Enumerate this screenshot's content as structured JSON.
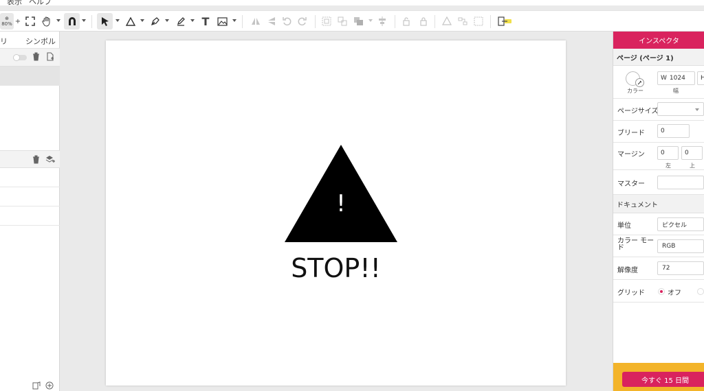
{
  "menu": {
    "view": "表示",
    "help": "ヘルプ"
  },
  "toolbar": {
    "zoom": "80%",
    "text_tool": "T",
    "plus": "+"
  },
  "left_panel": {
    "tab_left": "リ",
    "tab_symbol": "シンボル"
  },
  "canvas": {
    "exclaim": "!",
    "stop_text": "STOP!!"
  },
  "inspector": {
    "tab": "インスペクタ",
    "page_header": "ページ (ページ 1)",
    "color_caption": "カラー",
    "width_prefix": "W",
    "width_value": "1024",
    "width_caption": "幅",
    "height_prefix": "H",
    "page_size_label": "ページサイズ",
    "bleed_label": "ブリード",
    "bleed_value": "0",
    "margin_label": "マージン",
    "margin_left": "0",
    "margin_top": "0",
    "margin_left_caption": "左",
    "margin_top_caption": "上",
    "master_label": "マスター",
    "document_header": "ドキュメント",
    "unit_label": "単位",
    "unit_value": "ピクセル",
    "color_mode_label": "カラー モード",
    "color_mode_value": "RGB",
    "resolution_label": "解像度",
    "resolution_value": "72",
    "grid_label": "グリッド",
    "grid_off": "オフ",
    "trial_button": "今すぐ 15 日間"
  },
  "colors": {
    "accent": "#d9235e",
    "trial_bg": "#f3b42a"
  }
}
